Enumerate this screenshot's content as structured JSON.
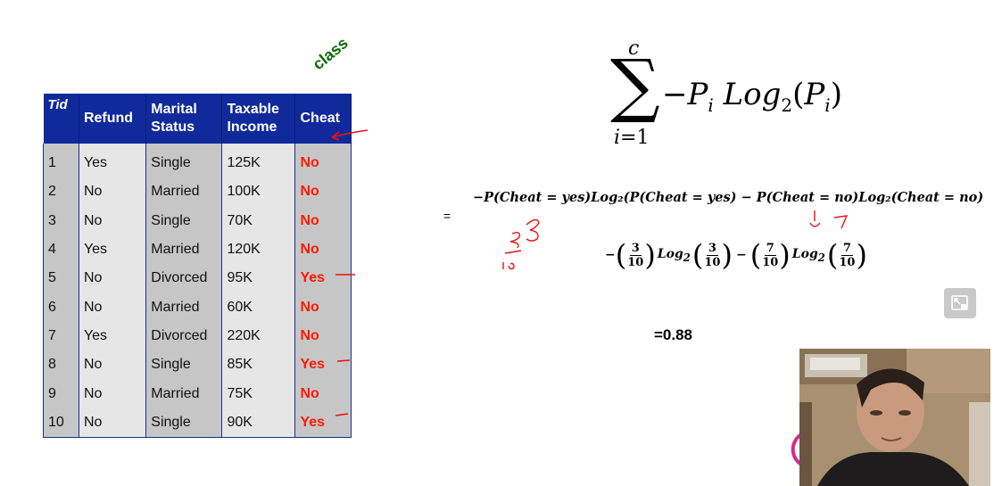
{
  "table": {
    "headers": {
      "tid": "Tid",
      "refund": "Refund",
      "marital_l1": "Marital",
      "marital_l2": "Status",
      "income_l1": "Taxable",
      "income_l2": "Income",
      "cheat": "Cheat"
    },
    "rows": [
      [
        "1",
        "Yes",
        "Single",
        "125K",
        "No"
      ],
      [
        "2",
        "No",
        "Married",
        "100K",
        "No"
      ],
      [
        "3",
        "No",
        "Single",
        "70K",
        "No"
      ],
      [
        "4",
        "Yes",
        "Married",
        "120K",
        "No"
      ],
      [
        "5",
        "No",
        "Divorced",
        "95K",
        "Yes"
      ],
      [
        "6",
        "No",
        "Married",
        "60K",
        "No"
      ],
      [
        "7",
        "Yes",
        "Divorced",
        "220K",
        "No"
      ],
      [
        "8",
        "No",
        "Single",
        "85K",
        "Yes"
      ],
      [
        "9",
        "No",
        "Married",
        "75K",
        "No"
      ],
      [
        "10",
        "No",
        "Single",
        "90K",
        "Yes"
      ]
    ]
  },
  "class_label": "class",
  "formula": {
    "sigma_upper": "c",
    "sigma_lower": "i=1",
    "sigma_expression": "−P",
    "sigma_sub_i": "i",
    "sigma_log": "Log",
    "sigma_log_base": "2",
    "sigma_arg": "(P",
    "sigma_arg_sub": "i",
    "sigma_close": ")",
    "eq_sign": "=",
    "line1": "−P(Cheat = yes)Log₂(P(Cheat = yes) − P(Cheat = no)Log₂(Cheat = no)",
    "line2": {
      "neg": "−",
      "num1": "3",
      "den1": "10",
      "log": "Log",
      "base": "2",
      "num2": "3",
      "den2": "10",
      "minus": "−",
      "num3": "7",
      "den3": "10",
      "num4": "7",
      "den4": "10"
    },
    "result": "=0.88"
  },
  "colors": {
    "header_bg": "#102a9c",
    "cheat_text": "#ff1a00",
    "class_label": "#0a6b0a"
  },
  "icons": {
    "exit_fullscreen": "exit-fullscreen-icon"
  }
}
